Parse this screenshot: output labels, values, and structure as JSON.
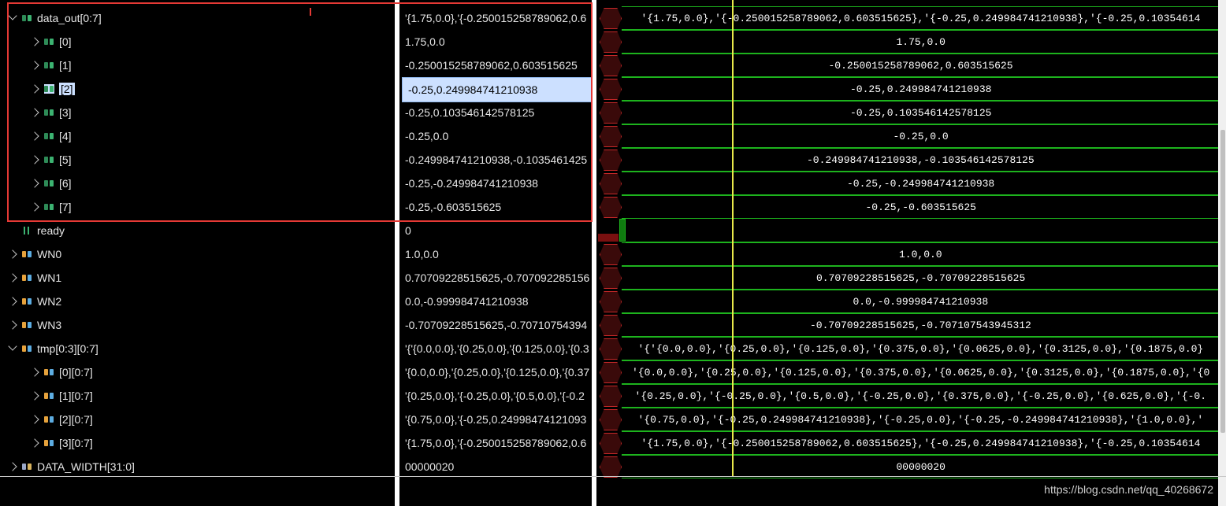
{
  "signals": [
    {
      "name": "data_out[0:7]",
      "value": "'{1.75,0.0},'{-0.250015258789062,0.6",
      "wave": "'{1.75,0.0},'{-0.250015258789062,0.603515625},'{-0.25,0.249984741210938},'{-0.25,0.10354614",
      "expand": "down",
      "icon": "arr"
    },
    {
      "name": "[0]",
      "value": "1.75,0.0",
      "wave": "1.75,0.0",
      "expand": "right",
      "icon": "arr"
    },
    {
      "name": "[1]",
      "value": "-0.250015258789062,0.603515625",
      "wave": "-0.250015258789062,0.603515625",
      "expand": "right",
      "icon": "arr"
    },
    {
      "name": "[2]",
      "value": "-0.25,0.249984741210938",
      "wave": "-0.25,0.249984741210938",
      "expand": "right",
      "icon": "arr",
      "selected": true
    },
    {
      "name": "[3]",
      "value": "-0.25,0.103546142578125",
      "wave": "-0.25,0.103546142578125",
      "expand": "right",
      "icon": "arr"
    },
    {
      "name": "[4]",
      "value": "-0.25,0.0",
      "wave": "-0.25,0.0",
      "expand": "right",
      "icon": "arr"
    },
    {
      "name": "[5]",
      "value": "-0.249984741210938,-0.1035461425",
      "wave": "-0.249984741210938,-0.103546142578125",
      "expand": "right",
      "icon": "arr"
    },
    {
      "name": "[6]",
      "value": "-0.25,-0.249984741210938",
      "wave": "-0.25,-0.249984741210938",
      "expand": "right",
      "icon": "arr"
    },
    {
      "name": "[7]",
      "value": "-0.25,-0.603515625",
      "wave": "-0.25,-0.603515625",
      "expand": "right",
      "icon": "arr"
    },
    {
      "name": "ready",
      "value": "0",
      "wave": "",
      "expand": "none",
      "icon": "ready"
    },
    {
      "name": "WN0",
      "value": "1.0,0.0",
      "wave": "1.0,0.0",
      "expand": "right",
      "icon": "tmp"
    },
    {
      "name": "WN1",
      "value": "0.70709228515625,-0.707092285156",
      "wave": "0.70709228515625,-0.70709228515625",
      "expand": "right",
      "icon": "tmp"
    },
    {
      "name": "WN2",
      "value": "0.0,-0.999984741210938",
      "wave": "0.0,-0.999984741210938",
      "expand": "right",
      "icon": "tmp"
    },
    {
      "name": "WN3",
      "value": "-0.70709228515625,-0.70710754394",
      "wave": "-0.70709228515625,-0.707107543945312",
      "expand": "right",
      "icon": "tmp"
    },
    {
      "name": "tmp[0:3][0:7]",
      "value": "'{'{0.0,0.0},'{0.25,0.0},'{0.125,0.0},'{0.3",
      "wave": "'{'{0.0,0.0},'{0.25,0.0},'{0.125,0.0},'{0.375,0.0},'{0.0625,0.0},'{0.3125,0.0},'{0.1875,0.0}",
      "expand": "down",
      "icon": "tmp"
    },
    {
      "name": "[0][0:7]",
      "value": "'{0.0,0.0},'{0.25,0.0},'{0.125,0.0},'{0.37",
      "wave": "'{0.0,0.0},'{0.25,0.0},'{0.125,0.0},'{0.375,0.0},'{0.0625,0.0},'{0.3125,0.0},'{0.1875,0.0},'{0",
      "expand": "right",
      "icon": "tmp"
    },
    {
      "name": "[1][0:7]",
      "value": "'{0.25,0.0},'{-0.25,0.0},'{0.5,0.0},'{-0.2",
      "wave": "'{0.25,0.0},'{-0.25,0.0},'{0.5,0.0},'{-0.25,0.0},'{0.375,0.0},'{-0.25,0.0},'{0.625,0.0},'{-0.",
      "expand": "right",
      "icon": "tmp"
    },
    {
      "name": "[2][0:7]",
      "value": "'{0.75,0.0},'{-0.25,0.24998474121093",
      "wave": "'{0.75,0.0},'{-0.25,0.249984741210938},'{-0.25,0.0},'{-0.25,-0.249984741210938},'{1.0,0.0},'",
      "expand": "right",
      "icon": "tmp"
    },
    {
      "name": "[3][0:7]",
      "value": "'{1.75,0.0},'{-0.250015258789062,0.6",
      "wave": "'{1.75,0.0},'{-0.250015258789062,0.603515625},'{-0.25,0.249984741210938},'{-0.25,0.10354614",
      "expand": "right",
      "icon": "tmp"
    },
    {
      "name": "DATA_WIDTH[31:0]",
      "value": "00000020",
      "wave": "00000020",
      "expand": "right",
      "icon": "param"
    }
  ],
  "watermark": "https://blog.csdn.net/qq_40268672",
  "colors": {
    "wave": "#1db31d",
    "cursor": "#e8e84a",
    "highlight": "#cce0ff",
    "annotation": "#e53935"
  }
}
